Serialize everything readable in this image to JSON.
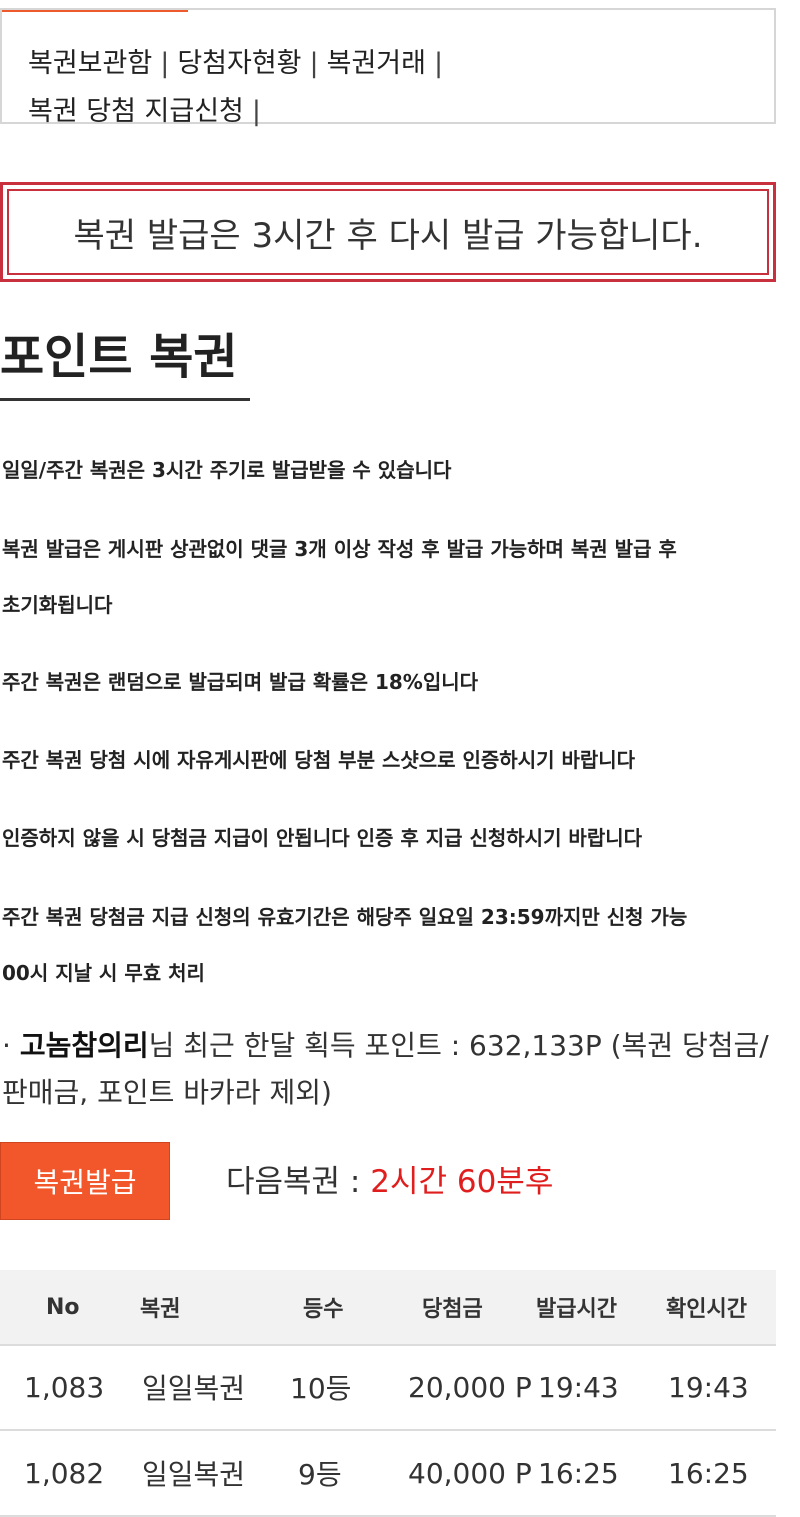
{
  "tabs": {
    "items": [
      {
        "label": "복권보관함"
      },
      {
        "label": "당첨자현황"
      },
      {
        "label": "복권거래"
      },
      {
        "label": "복권 당첨 지급신청"
      }
    ],
    "separator": "|"
  },
  "notice": {
    "text": "복권 발급은 3시간 후 다시 발급 가능합니다."
  },
  "section": {
    "title": "포인트 복권"
  },
  "rules": [
    "일일/주간 복권은 3시간 주기로 발급받을 수 있습니다",
    "복권 발급은 게시판 상관없이 댓글 3개 이상 작성 후 발급 가능하며 복권 발급 후",
    "초기화됩니다",
    "주간 복권은 랜덤으로 발급되며 발급 확률은 18%입니다",
    "주간 복권 당첨 시에 자유게시판에 당첨 부분 스샷으로 인증하시기 바랍니다",
    "인증하지 않을 시 당첨금 지급이 안됩니다 인증 후 지급 신청하시기 바랍니다",
    "주간 복권 당첨금 지급 신청의 유효기간은 해당주 일요일 23:59까지만 신청 가능",
    "00시 지날 시 무효 처리"
  ],
  "points": {
    "bullet": "·",
    "username": "고놈참의리",
    "text": "님 최근 한달 획득 포인트 : 632,133P (복권 당첨금/판매금, 포인트 바카라 제외)"
  },
  "issue": {
    "button_label": "복권발급",
    "next_label": "다음복권 : ",
    "next_value": "2시간 60분후"
  },
  "table": {
    "headers": [
      "No",
      "복권",
      "등수",
      "당첨금",
      "발급시간",
      "확인시간"
    ],
    "rows": [
      [
        "1,083",
        "일일복권",
        "10등",
        "20,000 P",
        "19:43",
        "19:43"
      ],
      [
        "1,082",
        "일일복권",
        "9등",
        "40,000 P",
        "16:25",
        "16:25"
      ]
    ]
  },
  "colors": {
    "accent": "#f2572b",
    "notice_border": "#c9303e",
    "next_value": "#e01e1e"
  }
}
